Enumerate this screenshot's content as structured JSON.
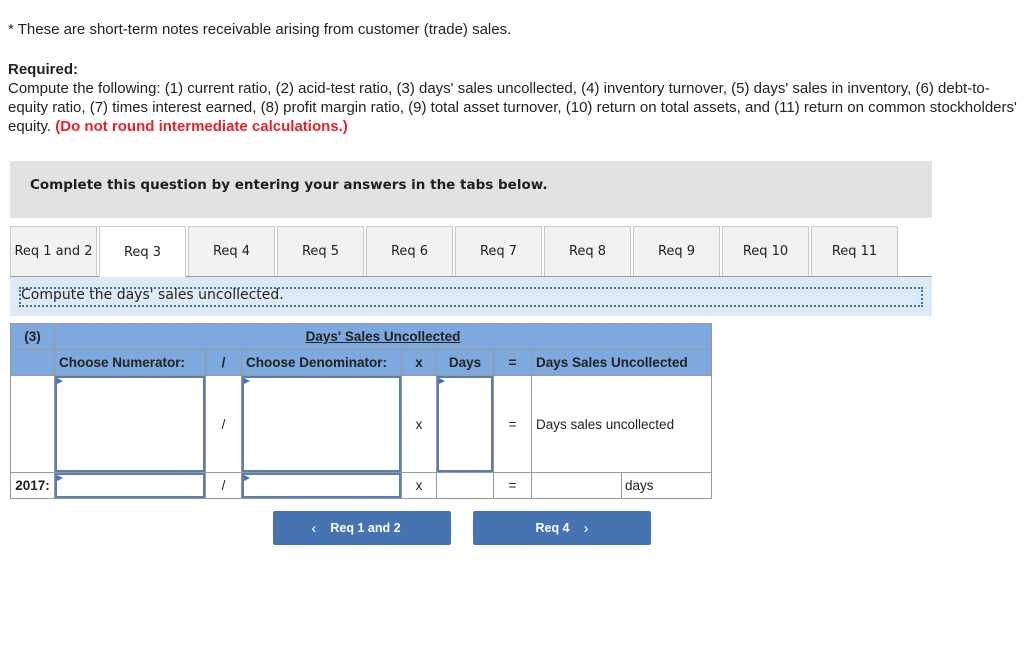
{
  "intro": {
    "footnote": "* These are short-term notes receivable arising from customer (trade) sales.",
    "required_heading": "Required:",
    "required_text": "Compute the following: (1) current ratio, (2) acid-test ratio, (3) days' sales uncollected, (4) inventory turnover, (5) days' sales in inventory, (6) debt-to-equity ratio, (7) times interest earned, (8) profit margin ratio, (9) total asset turnover, (10) return on total assets, and (11) return on common stockholders' equity.",
    "warning": "(Do not round intermediate calculations.)"
  },
  "banner": {
    "text": "Complete this question by entering your answers in the tabs below."
  },
  "tabs": [
    {
      "label": "Req 1 and 2",
      "active": false
    },
    {
      "label": "Req 3",
      "active": true
    },
    {
      "label": "Req 4",
      "active": false
    },
    {
      "label": "Req 5",
      "active": false
    },
    {
      "label": "Req 6",
      "active": false
    },
    {
      "label": "Req 7",
      "active": false
    },
    {
      "label": "Req 8",
      "active": false
    },
    {
      "label": "Req 9",
      "active": false
    },
    {
      "label": "Req 10",
      "active": false
    },
    {
      "label": "Req 11",
      "active": false
    }
  ],
  "instruction": "Compute the days' sales uncollected.",
  "table": {
    "part_label": "(3)",
    "title": "Days' Sales Uncollected",
    "headers": {
      "numerator": "Choose Numerator:",
      "divide": "/",
      "denominator": "Choose Denominator:",
      "times": "x",
      "days": "Days",
      "equals": "=",
      "result": "Days Sales Uncollected"
    },
    "formula_row": {
      "numerator_value": "",
      "divide": "/",
      "denominator_value": "",
      "times": "x",
      "days_value": "",
      "equals": "=",
      "result_label": "Days sales uncollected"
    },
    "year_row": {
      "year": "2017:",
      "numerator_value": "",
      "divide": "/",
      "denominator_value": "",
      "times": "x",
      "days_value": "",
      "equals": "=",
      "result_value": "",
      "unit": "days"
    }
  },
  "nav": {
    "prev_label": "Req 1 and 2",
    "next_label": "Req 4",
    "prev_icon": "‹",
    "next_icon": "›"
  }
}
